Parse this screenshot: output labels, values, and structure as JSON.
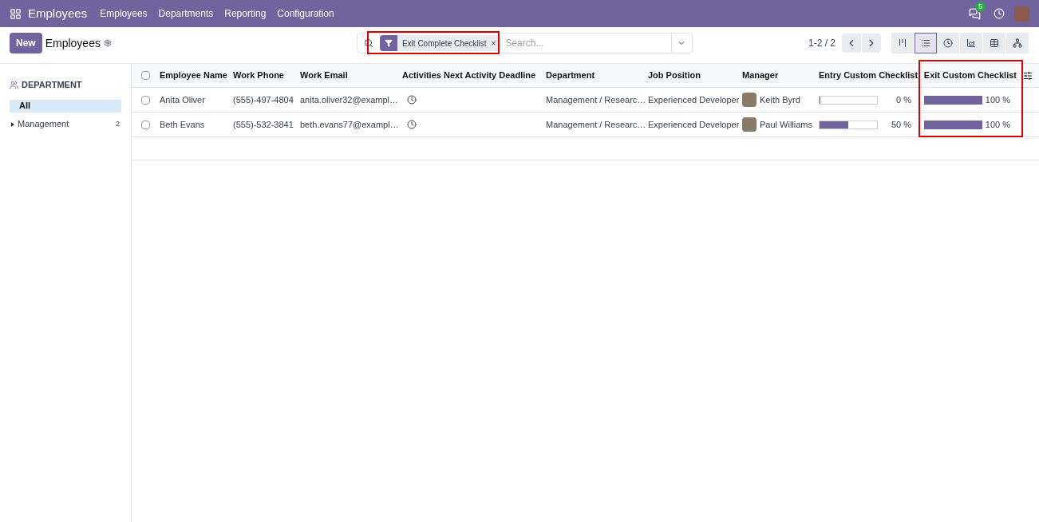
{
  "navbar": {
    "app_name": "Employees",
    "menu": [
      "Employees",
      "Departments",
      "Reporting",
      "Configuration"
    ],
    "messages_badge": "5"
  },
  "control_panel": {
    "new_button": "New",
    "breadcrumb": "Employees",
    "facet": {
      "label": "Exit Complete Checklist",
      "remove": "×"
    },
    "search_placeholder": "Search...",
    "pager": "1-2 / 2",
    "views": [
      {
        "kind": "kanban",
        "selected": false
      },
      {
        "kind": "list",
        "selected": true
      },
      {
        "kind": "activity",
        "selected": false
      },
      {
        "kind": "graph",
        "selected": false
      },
      {
        "kind": "pivot",
        "selected": false
      },
      {
        "kind": "hierarchy",
        "selected": false
      }
    ]
  },
  "sidebar": {
    "title": "DEPARTMENT",
    "items": [
      {
        "label": "All",
        "selected": true,
        "expandable": false
      },
      {
        "label": "Management",
        "count": "2",
        "selected": false,
        "expandable": true
      }
    ]
  },
  "table": {
    "all_selected": false,
    "columns": [
      "Employee Name",
      "Work Phone",
      "Work Email",
      "Activities",
      "Next Activity Deadline",
      "Department",
      "Job Position",
      "Manager",
      "Entry Custom Checklist",
      "Exit Custom Checklist"
    ],
    "rows": [
      {
        "selected": false,
        "name": "Anita Oliver",
        "phone": "(555)-497-4804",
        "email": "anita.oliver32@exampl…",
        "department": "Management / Researc…",
        "job": "Experienced Developer",
        "manager": "Keith Byrd",
        "entry": {
          "level": 0,
          "reading": "0 %"
        },
        "exit": {
          "level": 1,
          "reading": "100 %"
        }
      },
      {
        "selected": false,
        "name": "Beth Evans",
        "phone": "(555)-532-3841",
        "email": "beth.evans77@exampl…",
        "department": "Management / Researc…",
        "job": "Experienced Developer",
        "manager": "Paul Williams",
        "entry": {
          "level": 0.5,
          "reading": "50 %"
        },
        "exit": {
          "level": 1,
          "reading": "100 %"
        }
      }
    ]
  }
}
